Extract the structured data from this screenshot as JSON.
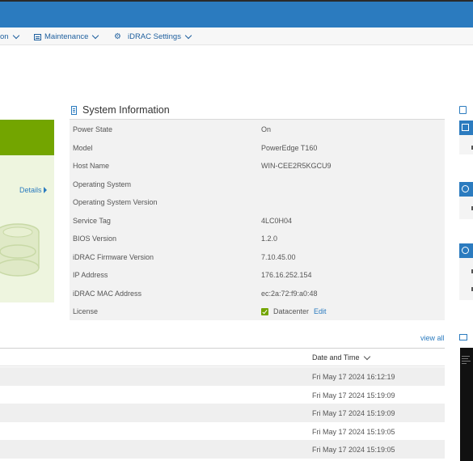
{
  "menu": {
    "items": [
      {
        "label": "on",
        "icon": "none"
      },
      {
        "label": "Maintenance",
        "icon": "maintenance-icon"
      },
      {
        "label": "iDRAC Settings",
        "icon": "gear-icon"
      }
    ]
  },
  "health": {
    "details_label": "Details",
    "status_color": "#73a500"
  },
  "system_info": {
    "title": "System Information",
    "rows": [
      {
        "key": "Power State",
        "value": "On"
      },
      {
        "key": "Model",
        "value": "PowerEdge T160"
      },
      {
        "key": "Host Name",
        "value": "WIN-CEE2R5KGCU9"
      },
      {
        "key": "Operating System",
        "value": ""
      },
      {
        "key": "Operating System Version",
        "value": ""
      },
      {
        "key": "Service Tag",
        "value": "4LC0H04"
      },
      {
        "key": "BIOS Version",
        "value": "1.2.0"
      },
      {
        "key": "iDRAC Firmware Version",
        "value": "7.10.45.00"
      },
      {
        "key": "IP Address",
        "value": "176.16.252.154"
      },
      {
        "key": "iDRAC MAC Address",
        "value": "ec:2a:72:f9:a0:48"
      },
      {
        "key": "License",
        "value": "Datacenter",
        "action": "Edit"
      }
    ]
  },
  "log": {
    "view_all": "view all",
    "column_header": "Date and Time",
    "entries": [
      "Fri May 17 2024 16:12:19",
      "Fri May 17 2024 15:19:09",
      "Fri May 17 2024 15:19:09",
      "Fri May 17 2024 15:19:05",
      "Fri May 17 2024 15:19:05"
    ]
  },
  "colors": {
    "banner": "#2b7bbf",
    "accent": "#1e5f9e",
    "healthy": "#73a500"
  }
}
